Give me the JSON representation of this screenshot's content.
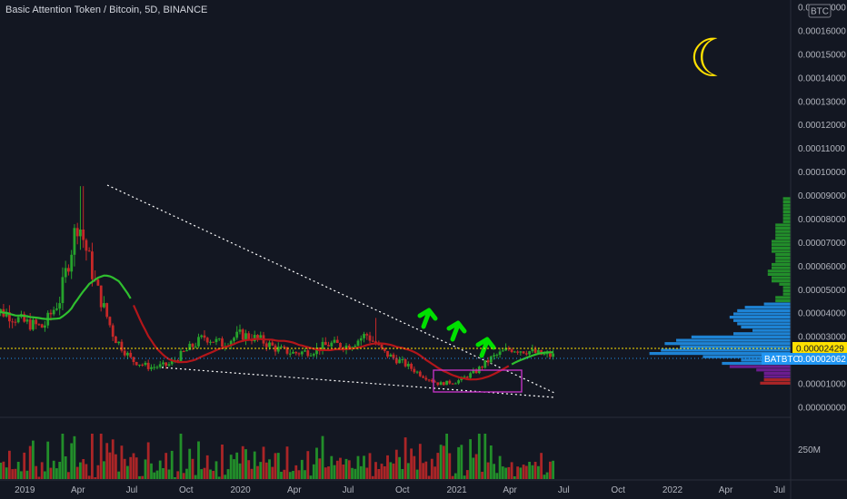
{
  "header": {
    "title": "Basic Attention Token / Bitcoin, 5D, BINANCE"
  },
  "currency_badge": "BTC",
  "moon_glyph": "☾",
  "colors": {
    "background": "#131722",
    "up": "#26a32c",
    "down": "#c62828",
    "ma": "#2fbf2f",
    "ma2": "#b3161a",
    "vp_up": "#7b1fa2",
    "vp_poc": "#2196f3",
    "accent": "#2196f3",
    "arrow": "#00e000",
    "box": "#cc33cc",
    "moon": "#ffe000"
  },
  "price_axis": {
    "ticks": [
      "0.00017000",
      "0.00016000",
      "0.00015000",
      "0.00014000",
      "0.00013000",
      "0.00012000",
      "0.00011000",
      "0.00010000",
      "0.00009000",
      "0.00008000",
      "0.00007000",
      "0.00006000",
      "0.00005000",
      "0.00004000",
      "0.00003000",
      "0.00001000",
      "0.00000000"
    ],
    "last_price_label": "0.00002429",
    "symbol_label": "BATBTC",
    "symbol_price": "0.00002062"
  },
  "volume_axis": {
    "label": "250M"
  },
  "time_axis": {
    "labels": [
      "2019",
      "Apr",
      "Jul",
      "Oct",
      "2020",
      "Apr",
      "Jul",
      "Oct",
      "2021",
      "Apr",
      "Jul",
      "Oct",
      "2022",
      "Apr",
      "Jul"
    ]
  },
  "chart_data": {
    "type": "candlestick",
    "title": "Basic Attention Token / Bitcoin, 5D, BINANCE",
    "ylim": [
      0,
      0.00017
    ],
    "x_range": [
      "2018-11-20",
      "2022-07-20"
    ],
    "series": [
      {
        "name": "BATBTC",
        "points": [
          {
            "date": "2018-11",
            "close": 4.2e-05
          },
          {
            "date": "2018-12",
            "close": 4e-05
          },
          {
            "date": "2019-01",
            "close": 3.6e-05
          },
          {
            "date": "2019-02",
            "close": 3.4e-05
          },
          {
            "date": "2019-03",
            "close": 4.6e-05
          },
          {
            "date": "2019-04",
            "close": 8e-05
          },
          {
            "date": "2019-05",
            "close": 5.2e-05
          },
          {
            "date": "2019-06",
            "close": 3e-05
          },
          {
            "date": "2019-07",
            "close": 2e-05
          },
          {
            "date": "2019-08",
            "close": 1.7e-05
          },
          {
            "date": "2019-09",
            "close": 1.8e-05
          },
          {
            "date": "2019-10",
            "close": 2.4e-05
          },
          {
            "date": "2019-11",
            "close": 3e-05
          },
          {
            "date": "2019-12",
            "close": 2.7e-05
          },
          {
            "date": "2020-01",
            "close": 3.1e-05
          },
          {
            "date": "2020-02",
            "close": 2.9e-05
          },
          {
            "date": "2020-03",
            "close": 2.5e-05
          },
          {
            "date": "2020-04",
            "close": 2.3e-05
          },
          {
            "date": "2020-05",
            "close": 2.4e-05
          },
          {
            "date": "2020-06",
            "close": 2.7e-05
          },
          {
            "date": "2020-07",
            "close": 2.6e-05
          },
          {
            "date": "2020-08",
            "close": 3.1e-05
          },
          {
            "date": "2020-09",
            "close": 2.3e-05
          },
          {
            "date": "2020-10",
            "close": 1.9e-05
          },
          {
            "date": "2020-11",
            "close": 1.4e-05
          },
          {
            "date": "2020-12",
            "close": 1e-05
          },
          {
            "date": "2021-01",
            "close": 1.1e-05
          },
          {
            "date": "2021-02",
            "close": 1.5e-05
          },
          {
            "date": "2021-03",
            "close": 2.1e-05
          },
          {
            "date": "2021-04",
            "close": 2.5e-05
          },
          {
            "date": "2021-05",
            "close": 2.4e-05
          },
          {
            "date": "2021-06",
            "close": 2.2e-05
          }
        ]
      }
    ],
    "last_price": 2.429e-05,
    "symbol_price": 2.062e-05,
    "xlabel": "",
    "ylabel": ""
  }
}
